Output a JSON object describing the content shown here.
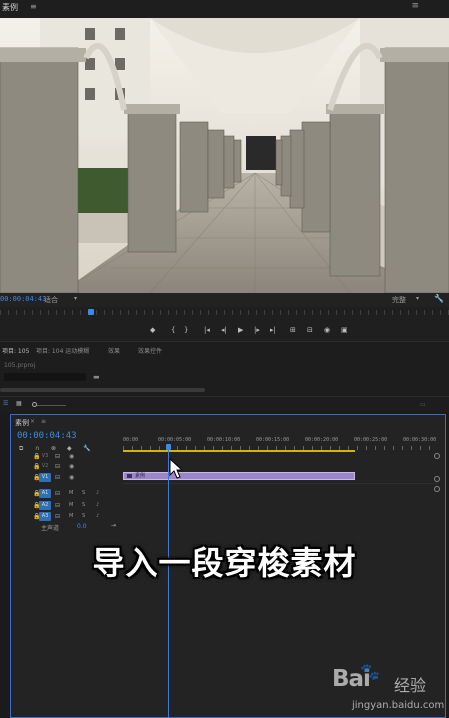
{
  "monitor": {
    "title": "素例",
    "menu_glyph": "≡",
    "close_glyph": "≡",
    "timecode": "00:00:04:43",
    "fit_label": "适合",
    "quality_label": "完整"
  },
  "transport": {
    "buttons": [
      "marker",
      "in",
      "out",
      "go-to-in",
      "step-back",
      "play",
      "step-forward",
      "go-to-out",
      "lift",
      "extract",
      "export-frame",
      "compare"
    ]
  },
  "project": {
    "tabs": [
      "项目: 105",
      "项目: 104 运动模糊",
      "效果",
      "效果控件"
    ],
    "file": "105.prproj"
  },
  "timeline": {
    "tab_title": "素例",
    "timecode": "00:00:04:43",
    "ruler": [
      "00:00",
      "00:00:05:00",
      "00:00:10:00",
      "00:00:15:00",
      "00:00:20:00",
      "00:00:25:00",
      "00:00:30:00"
    ],
    "tracks": [
      {
        "id": "V3",
        "type": "video",
        "targeted": false
      },
      {
        "id": "V2",
        "type": "video",
        "targeted": false
      },
      {
        "id": "V1",
        "type": "video",
        "targeted": true
      },
      {
        "id": "A1",
        "type": "audio",
        "targeted": true
      },
      {
        "id": "A2",
        "type": "audio",
        "targeted": true
      },
      {
        "id": "A3",
        "type": "audio",
        "targeted": true
      }
    ],
    "track_m": "M",
    "track_s": "S",
    "master_label": "主声道",
    "master_value": "0.0",
    "clip_label": "素例"
  },
  "subtitle": "导入一段穿梭素材",
  "watermark": {
    "brand": "Bai",
    "brand_suffix": "经验",
    "url": "jingyan.baidu.com"
  },
  "colors": {
    "accent_blue": "#3b8be6",
    "clip_purple": "#9b86c9",
    "work_area_yellow": "#d8b400"
  }
}
